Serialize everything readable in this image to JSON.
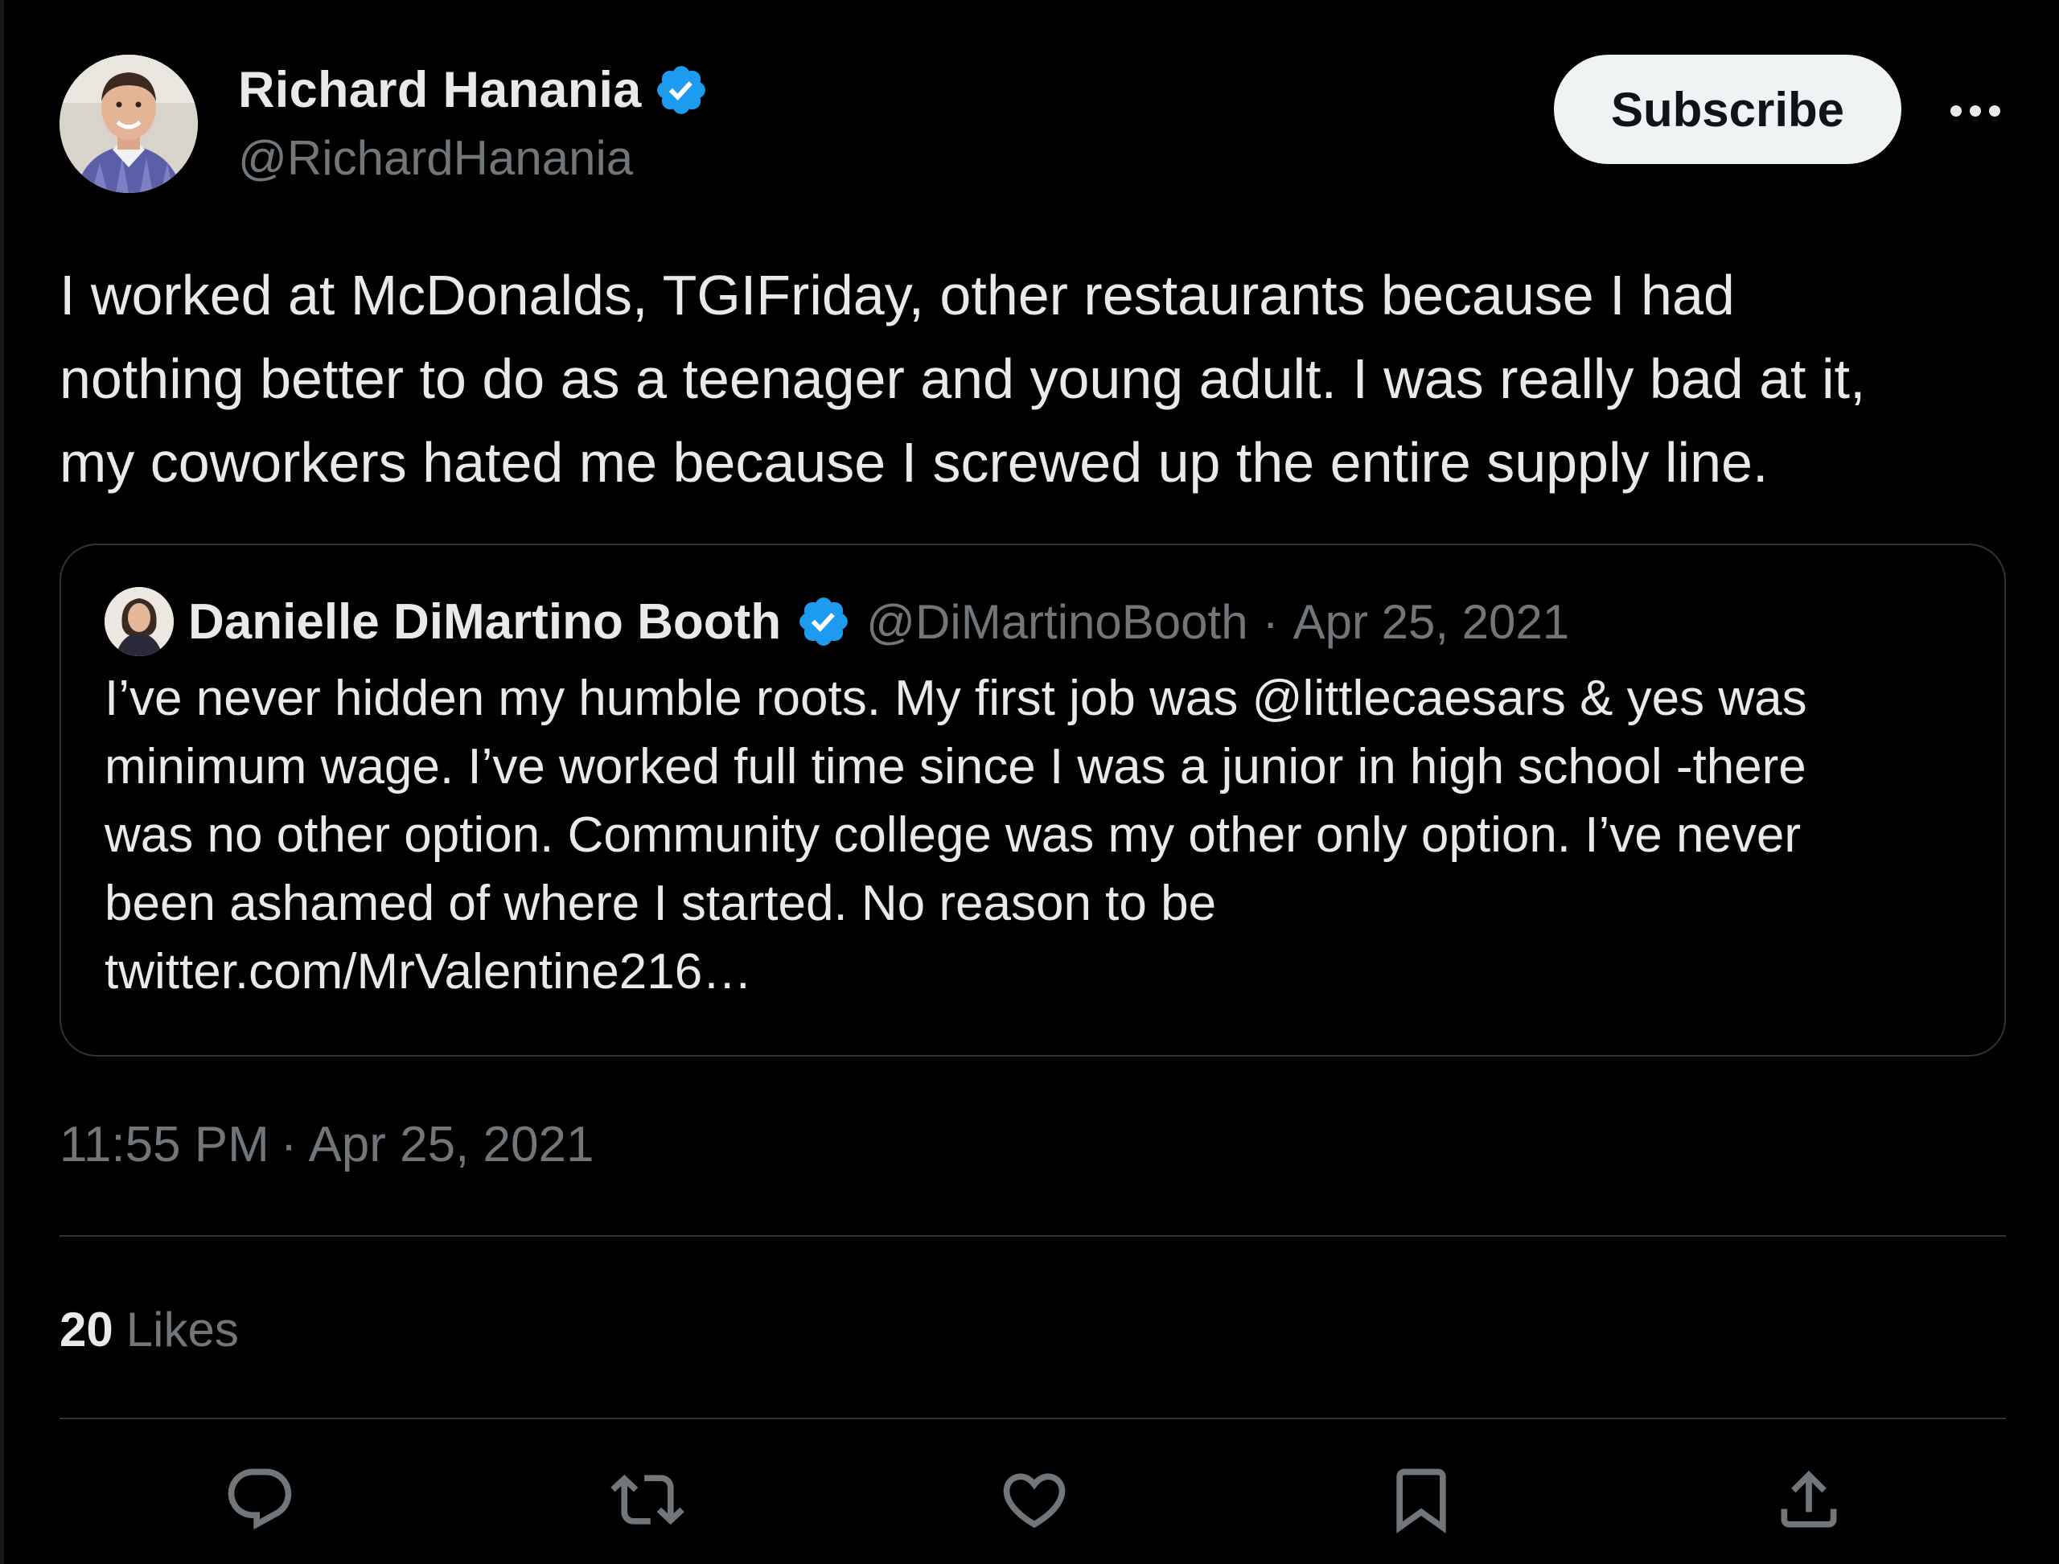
{
  "author": {
    "name": "Richard Hanania",
    "handle": "@RichardHanania",
    "verified_color": "#1d9bf0"
  },
  "subscribe_label": "Subscribe",
  "tweet": {
    "lines": [
      "I worked at McDonalds, TGIFriday, other restaurants because I had",
      "nothing better to do as a teenager and young adult. I was really bad at it,",
      "my coworkers hated me because I screwed up the entire supply line."
    ]
  },
  "quote": {
    "name": "Danielle DiMartino Booth",
    "handle": "@DiMartinoBooth",
    "separator": "·",
    "date": "Apr 25, 2021",
    "lines": [
      "I’ve never hidden my humble roots. My first job was @littlecaesars & yes was",
      "minimum wage. I’ve worked full time since I was a junior in high school -there",
      "was no other option. Community college was my other only option. I’ve never",
      "been ashamed of where I started. No reason to be",
      "twitter.com/MrValentine216…"
    ]
  },
  "timestamp": {
    "time": "11:55 PM",
    "separator": "·",
    "date": "Apr 25, 2021"
  },
  "likes": {
    "count": "20",
    "label": "Likes"
  },
  "actions": [
    {
      "icon": "reply-icon"
    },
    {
      "icon": "retweet-icon"
    },
    {
      "icon": "like-icon"
    },
    {
      "icon": "bookmark-icon"
    },
    {
      "icon": "share-icon"
    }
  ],
  "colors": {
    "background": "#000000",
    "text": "#e7e9ea",
    "secondary": "#71767b",
    "border": "#2f3336",
    "accent": "#1d9bf0"
  }
}
